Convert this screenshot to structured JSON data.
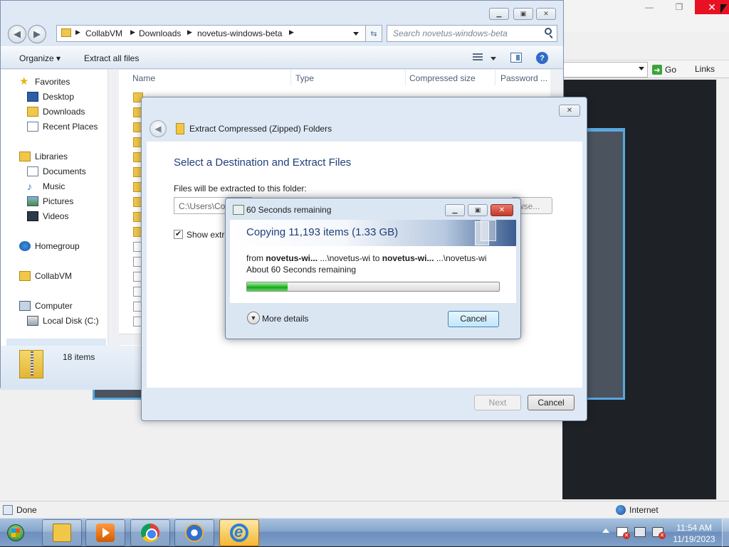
{
  "ie": {
    "minimize_label": "—",
    "restore_label": "❐",
    "close_label": "✕",
    "go_label": "Go",
    "links_label": "Links",
    "status_text": "Done",
    "zone_text": "Internet"
  },
  "explorer": {
    "breadcrumb": [
      "CollabVM",
      "Downloads",
      "novetus-windows-beta"
    ],
    "search_placeholder": "Search novetus-windows-beta",
    "toolbar": {
      "organize_label": "Organize ▾",
      "extract_label": "Extract all files"
    },
    "nav": {
      "favorites": "Favorites",
      "desktop": "Desktop",
      "downloads": "Downloads",
      "recent": "Recent Places",
      "libraries": "Libraries",
      "documents": "Documents",
      "music": "Music",
      "pictures": "Pictures",
      "videos": "Videos",
      "homegroup": "Homegroup",
      "collabvm": "CollabVM",
      "computer": "Computer",
      "local_disk": "Local Disk (C:)"
    },
    "columns": [
      "Name",
      "Type",
      "Compressed size",
      "Password ..."
    ],
    "item_count": "18 items"
  },
  "wizard": {
    "title": "Extract Compressed (Zipped) Folders",
    "heading": "Select a Destination and Extract Files",
    "folder_label": "Files will be extracted to this folder:",
    "path_value": "C:\\Users\\Co",
    "browse_label": "wse...",
    "show_label": "Show extra",
    "next_label": "Next",
    "cancel_label": "Cancel"
  },
  "copy": {
    "title": "60 Seconds remaining",
    "heading": "Copying 11,193 items (1.33 GB)",
    "from_prefix": "from ",
    "from_name": "novetus-wi...",
    "from_path": " ...\\novetus-wi",
    "to_word": " to ",
    "to_name": "novetus-wi...",
    "to_path": " ...\\novetus-wi",
    "remaining": "About 60 Seconds remaining",
    "progress_percent": 16,
    "more_details": "More details",
    "cancel_label": "Cancel"
  },
  "taskbar": {
    "time": "11:54 AM",
    "date": "11/19/2023"
  }
}
